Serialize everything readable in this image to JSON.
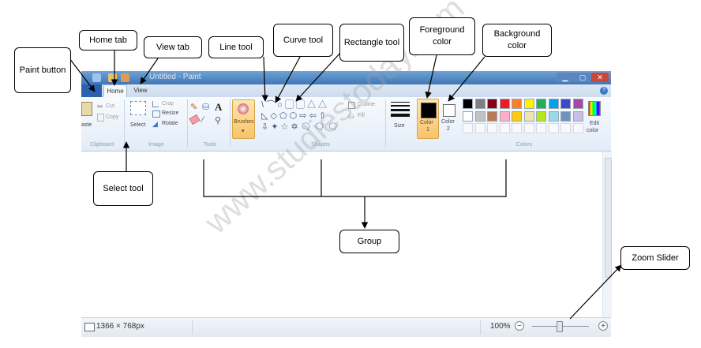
{
  "window": {
    "title": "Untitled - Paint",
    "tabs": {
      "home": "Home",
      "view": "View"
    },
    "help": "?"
  },
  "ribbon": {
    "clipboard": {
      "label": "Clipboard",
      "paste": "aste",
      "cut": "Cut",
      "copy": "Copy"
    },
    "image": {
      "label": "Image",
      "select": "Select",
      "crop": "Crop",
      "resize": "Resize",
      "rotate": "Rotate"
    },
    "tools": {
      "label": "Tools",
      "text_tool": "A"
    },
    "brushes": {
      "label": "Brushes"
    },
    "shapes": {
      "label": "Shapes",
      "row1": "\\ ⌒ ○ ▢ ▢ △ △",
      "row2": "◺ ◇ ⬠ ⬡ ⇨ ⇦ ⇧",
      "row3": "⇩ ✦ ☆ ✡ 🗨 🗨 🗨",
      "outline": "Outline",
      "fill": "Fill"
    },
    "size": {
      "label": "Size"
    },
    "colors": {
      "label": "Colors",
      "color1": "Color\n1",
      "color1_line1": "Color",
      "color1_line2": "1",
      "color2_line1": "Color",
      "color2_line2": "2",
      "edit_line1": "Edit",
      "edit_line2": "color",
      "foreground": "#000000",
      "background": "#ffffff",
      "palette_row1": [
        "#000000",
        "#7f7f7f",
        "#880015",
        "#ed1c24",
        "#ff7f27",
        "#fff200",
        "#22b14c",
        "#00a2e8",
        "#3f48cc",
        "#a349a4"
      ],
      "palette_row2": [
        "#ffffff",
        "#c3c3c3",
        "#b97a57",
        "#ffaec9",
        "#ffc90e",
        "#efe4b0",
        "#b5e61d",
        "#99d9ea",
        "#7092be",
        "#c8bfe7"
      ]
    }
  },
  "status": {
    "canvas_size": "1366 × 768px",
    "zoom": "100%",
    "zoom_out": "−",
    "zoom_in": "+"
  },
  "annotations": {
    "paint_button": "Paint button",
    "home_tab": "Home tab",
    "view_tab": "View tab",
    "line_tool": "Line tool",
    "curve_tool": "Curve tool",
    "rectangle_tool": "Rectangle tool",
    "foreground_color": "Foreground color",
    "background_color": "Background color",
    "select_tool": "Select tool",
    "group": "Group",
    "zoom_slider": "Zoom Slider"
  },
  "watermark": "www.studiestoday.com"
}
